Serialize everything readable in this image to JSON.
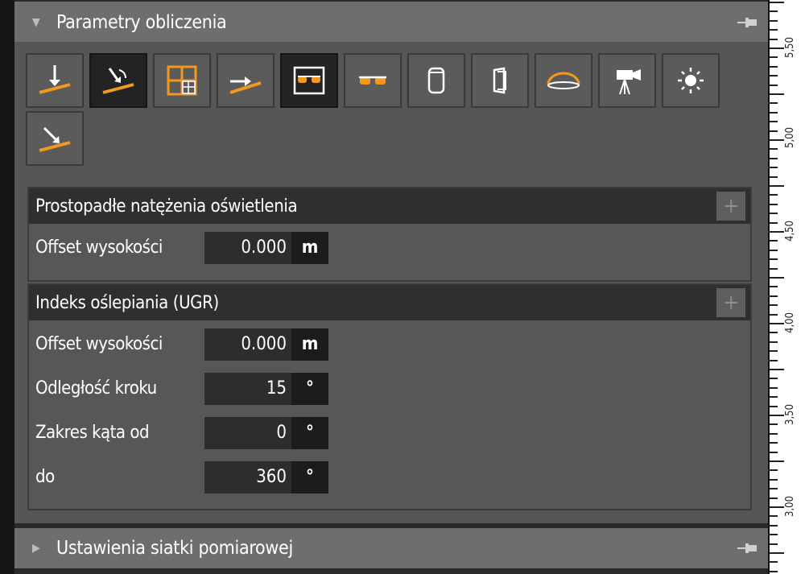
{
  "colors": {
    "accent": "#f39a1e",
    "panel_bg": "#565656",
    "header_bg": "#6e6e6e",
    "section_head": "#2f2f2f"
  },
  "panel": {
    "title": "Parametry obliczenia",
    "collapse_icon": "chevron-down-icon",
    "pin_icon": "pin-icon"
  },
  "toolbar": [
    {
      "icon": "perpendicular-illuminance-icon"
    },
    {
      "icon": "inclined-illuminance-icon"
    },
    {
      "icon": "grid-illuminance-icon"
    },
    {
      "icon": "horizontal-illuminance-icon"
    },
    {
      "icon": "glasses-framed-icon"
    },
    {
      "icon": "glasses-icon"
    },
    {
      "icon": "cylindrical-illuminance-icon"
    },
    {
      "icon": "semicylindrical-illuminance-icon"
    },
    {
      "icon": "hemispherical-illuminance-icon"
    },
    {
      "icon": "camera-icon"
    },
    {
      "icon": "sun-icon"
    },
    {
      "icon": "normal-illuminance-icon"
    }
  ],
  "sections": {
    "perpendicular": {
      "title": "Prostopadłe natężenia oświetlenia",
      "add_label": "+",
      "rows": [
        {
          "label": "Offset wysokości",
          "value": "0.000",
          "unit": "m"
        }
      ]
    },
    "ugr": {
      "title": "Indeks oślepiania (UGR)",
      "add_label": "+",
      "rows": [
        {
          "label": "Offset wysokości",
          "value": "0.000",
          "unit": "m"
        },
        {
          "label": "Odległość kroku",
          "value": "15",
          "unit": "°"
        },
        {
          "label": "Zakres kąta od",
          "value": "0",
          "unit": "°"
        },
        {
          "label": "do",
          "value": "360",
          "unit": "°"
        }
      ]
    }
  },
  "footer_panel": {
    "title": "Ustawienia siatki pomiarowej",
    "expand_icon": "chevron-right-icon",
    "pin_icon": "pin-icon"
  },
  "ruler": {
    "labels": [
      "5,50",
      "5,00",
      "4,50",
      "4,00",
      "3,50",
      "3,00"
    ]
  }
}
